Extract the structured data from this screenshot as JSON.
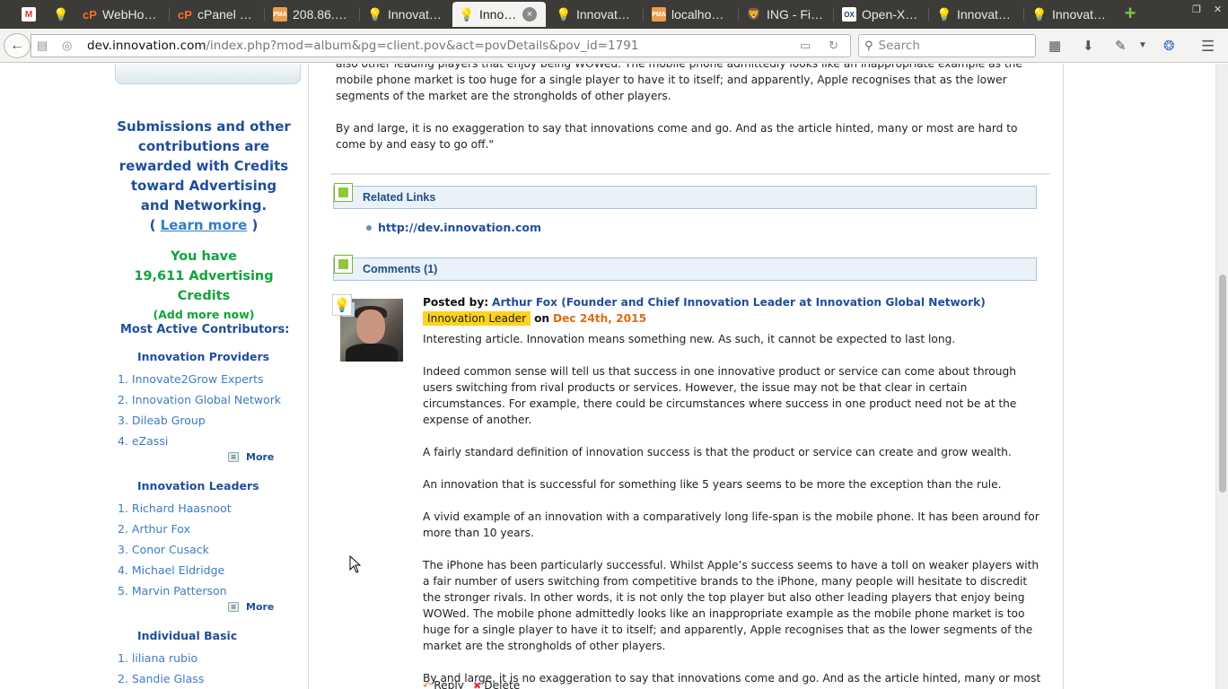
{
  "browser": {
    "tabs": [
      {
        "icon": "gmail-icon",
        "label": ""
      },
      {
        "icon": "bulb-icon",
        "label": ""
      },
      {
        "icon": "cpanel-icon",
        "label": "WebHo…"
      },
      {
        "icon": "cpanel-icon",
        "label": "cPanel …"
      },
      {
        "icon": "phpmyadmin-icon",
        "label": "208.86.…"
      },
      {
        "icon": "bulb-icon",
        "label": "Innovat…"
      },
      {
        "icon": "bulb-icon",
        "label": "Inno…"
      },
      {
        "icon": "bulb-icon",
        "label": "Innovat…"
      },
      {
        "icon": "phpmyadmin-icon",
        "label": "localho…"
      },
      {
        "icon": "ing-icon",
        "label": "ING - Fi…"
      },
      {
        "icon": "ox-icon",
        "label": "Open-X…"
      },
      {
        "icon": "bulb-icon",
        "label": "Innovat…"
      },
      {
        "icon": "bulb-icon",
        "label": "Innovat…"
      }
    ],
    "url_domain": "dev.innovation.com",
    "url_path": "/index.php?mod=album&pg=client.pov&act=povDetails&pov_id=1791",
    "search_placeholder": "Search"
  },
  "sidebar": {
    "promo_line1": "Submissions and other",
    "promo_line2": "contributions are",
    "promo_line3": "rewarded with Credits",
    "promo_line4": "toward Advertising",
    "promo_line5": "and Networking.",
    "learn_more_prefix": "( ",
    "learn_more": "Learn more",
    "learn_more_suffix": " )",
    "credits_line1": "You have",
    "credits_line2": "19,611 Advertising Credits",
    "add_more": "(Add more now)",
    "contributors_title": "Most Active Contributors:",
    "groups": [
      {
        "title": "Innovation Providers",
        "items": [
          "1. Innovate2Grow Experts",
          "2. Innovation Global Network",
          "3. Dileab Group",
          "4. eZassi"
        ],
        "more": "More"
      },
      {
        "title": "Innovation Leaders",
        "items": [
          "1. Richard Haasnoot",
          "2. Arthur Fox",
          "3. Conor Cusack",
          "4. Michael Eldridge",
          "5. Marvin Patterson"
        ],
        "more": "More"
      },
      {
        "title": "Individual Basic",
        "items": [
          "1. liliana rubio",
          "2. Sandie Glass"
        ]
      }
    ]
  },
  "article": {
    "top_para_1": "also other leading players that enjoy being WOWed. The mobile phone admittedly looks like an inappropriate example as the mobile phone market is too huge for a single player to have it to itself; and apparently, Apple recognises that as the lower segments of the market are the strongholds of other players.",
    "top_para_2": "By and large, it is no exaggeration to say that innovations come and go. And as the article hinted, many or most are hard to come by and easy to go off.\""
  },
  "related": {
    "header": "Related Links",
    "link": "http://dev.innovation.com"
  },
  "comments": {
    "header": "Comments (1)",
    "posted_by": "Posted by:",
    "author": "Arthur Fox (Founder and Chief Innovation Leader at Innovation Global Network)",
    "badge": "Innovation Leader",
    "on": "on",
    "date": "Dec 24th, 2015",
    "paragraphs": [
      "Interesting article.  Innovation means something new. As such, it cannot be expected to last long.",
      "Indeed common sense will tell us that success in one innovative product or service can come about through users switching from rival products or services. However, the issue may not be that clear in certain circumstances. For example, there could be circumstances where success in one product need not be at the expense of another.",
      "A fairly standard definition of innovation success is that the product or service can create and grow wealth.",
      "An innovation that is successful for something like 5 years seems to be more the exception than the rule.",
      "A vivid example of an innovation with a comparatively long life-span is the mobile phone. It has been around for more than 10 years.",
      "The iPhone has been particularly successful. Whilst Apple’s success seems to have a toll on weaker players with a fair number of users switching from competitive brands to the iPhone, many people will hesitate to discredit the stronger rivals. In other words, it is not only the top player but also other leading players that enjoy being WOWed. The mobile phone admittedly looks like an inappropriate example as the mobile phone market is too huge for a single player to have it to itself; and apparently, Apple recognises that as the lower segments of the market are the strongholds of other players.",
      "By and large, it is no exaggeration to say that innovations come and go. And as the article hinted, many or most are hard to come by and easy to go off.\""
    ],
    "reply": "Reply",
    "delete": "Delete"
  }
}
